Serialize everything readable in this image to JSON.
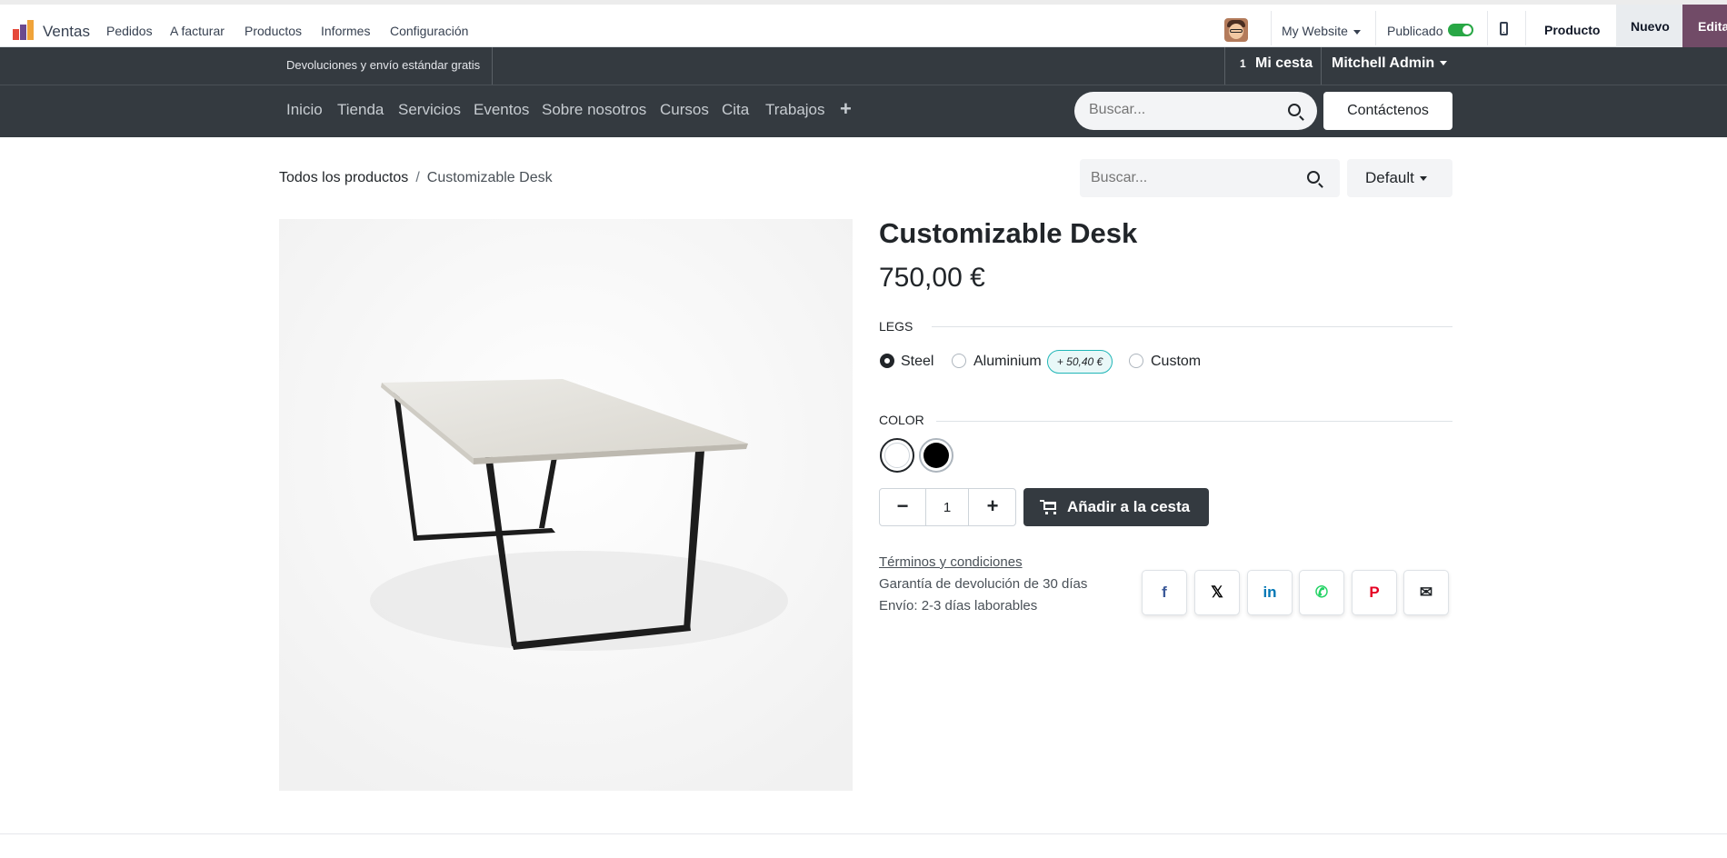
{
  "app": {
    "name": "Ventas",
    "menu": [
      "Pedidos",
      "A facturar",
      "Productos",
      "Informes",
      "Configuración"
    ]
  },
  "admin_bar": {
    "website": "My Website",
    "published_label": "Publicado",
    "published": true,
    "product_label": "Producto",
    "new_label": "Nuevo",
    "edit_label": "Editar"
  },
  "site_header": {
    "promo": "Devoluciones y envío estándar gratis",
    "cart_count": "1",
    "cart_label": "Mi cesta",
    "user": "Mitchell Admin",
    "nav": [
      "Inicio",
      "Tienda",
      "Servicios",
      "Eventos",
      "Sobre nosotros",
      "Cursos",
      "Cita",
      "Trabajos"
    ],
    "search_placeholder": "Buscar...",
    "contact_label": "Contáctenos"
  },
  "shop_bar": {
    "breadcrumb": [
      "Todos los productos",
      "Customizable Desk"
    ],
    "search_placeholder": "Buscar...",
    "sort_label": "Default"
  },
  "product": {
    "name": "Customizable Desk",
    "price": "750,00 €",
    "attributes": {
      "legs": {
        "label": "LEGS",
        "options": [
          "Steel",
          "Aluminium",
          "Custom"
        ],
        "selected": "Steel",
        "aluminium_extra": "+ 50,40 €"
      },
      "color": {
        "label": "COLOR",
        "swatches": [
          "#ffffff",
          "#000000"
        ],
        "selected": "#ffffff"
      }
    },
    "quantity": "1",
    "add_to_cart_label": "Añadir a la cesta",
    "terms_label": "Términos y condiciones",
    "guarantee": "Garantía de devolución de 30 días",
    "shipping": "Envío: 2-3 días laborables"
  },
  "share": {
    "icons": [
      "facebook-icon",
      "x-icon",
      "linkedin-icon",
      "whatsapp-icon",
      "pinterest-icon",
      "email-icon"
    ],
    "labels": [
      "f",
      "𝕏",
      "in",
      "✆",
      "P",
      "✉"
    ],
    "colors": [
      "#3b5998",
      "#000000",
      "#0077b5",
      "#25d366",
      "#e60023",
      "#212529"
    ]
  },
  "colors": {
    "brand": "#714b67",
    "header_dark": "#343a40",
    "accent_teal": "#21b6b7",
    "toggle_on": "#28a745"
  }
}
